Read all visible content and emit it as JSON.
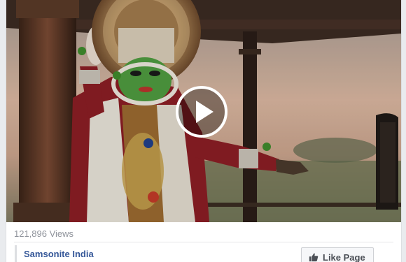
{
  "video": {
    "views_text": "121,896 Views",
    "play_icon": "play-icon"
  },
  "page": {
    "name": "Samsonite India",
    "like_label": "Like Page",
    "like_icon": "thumbs-up-icon"
  },
  "colors": {
    "link": "#365899",
    "muted": "#90949c",
    "button_bg": "#f6f7f9",
    "button_border": "#ced0d4"
  }
}
